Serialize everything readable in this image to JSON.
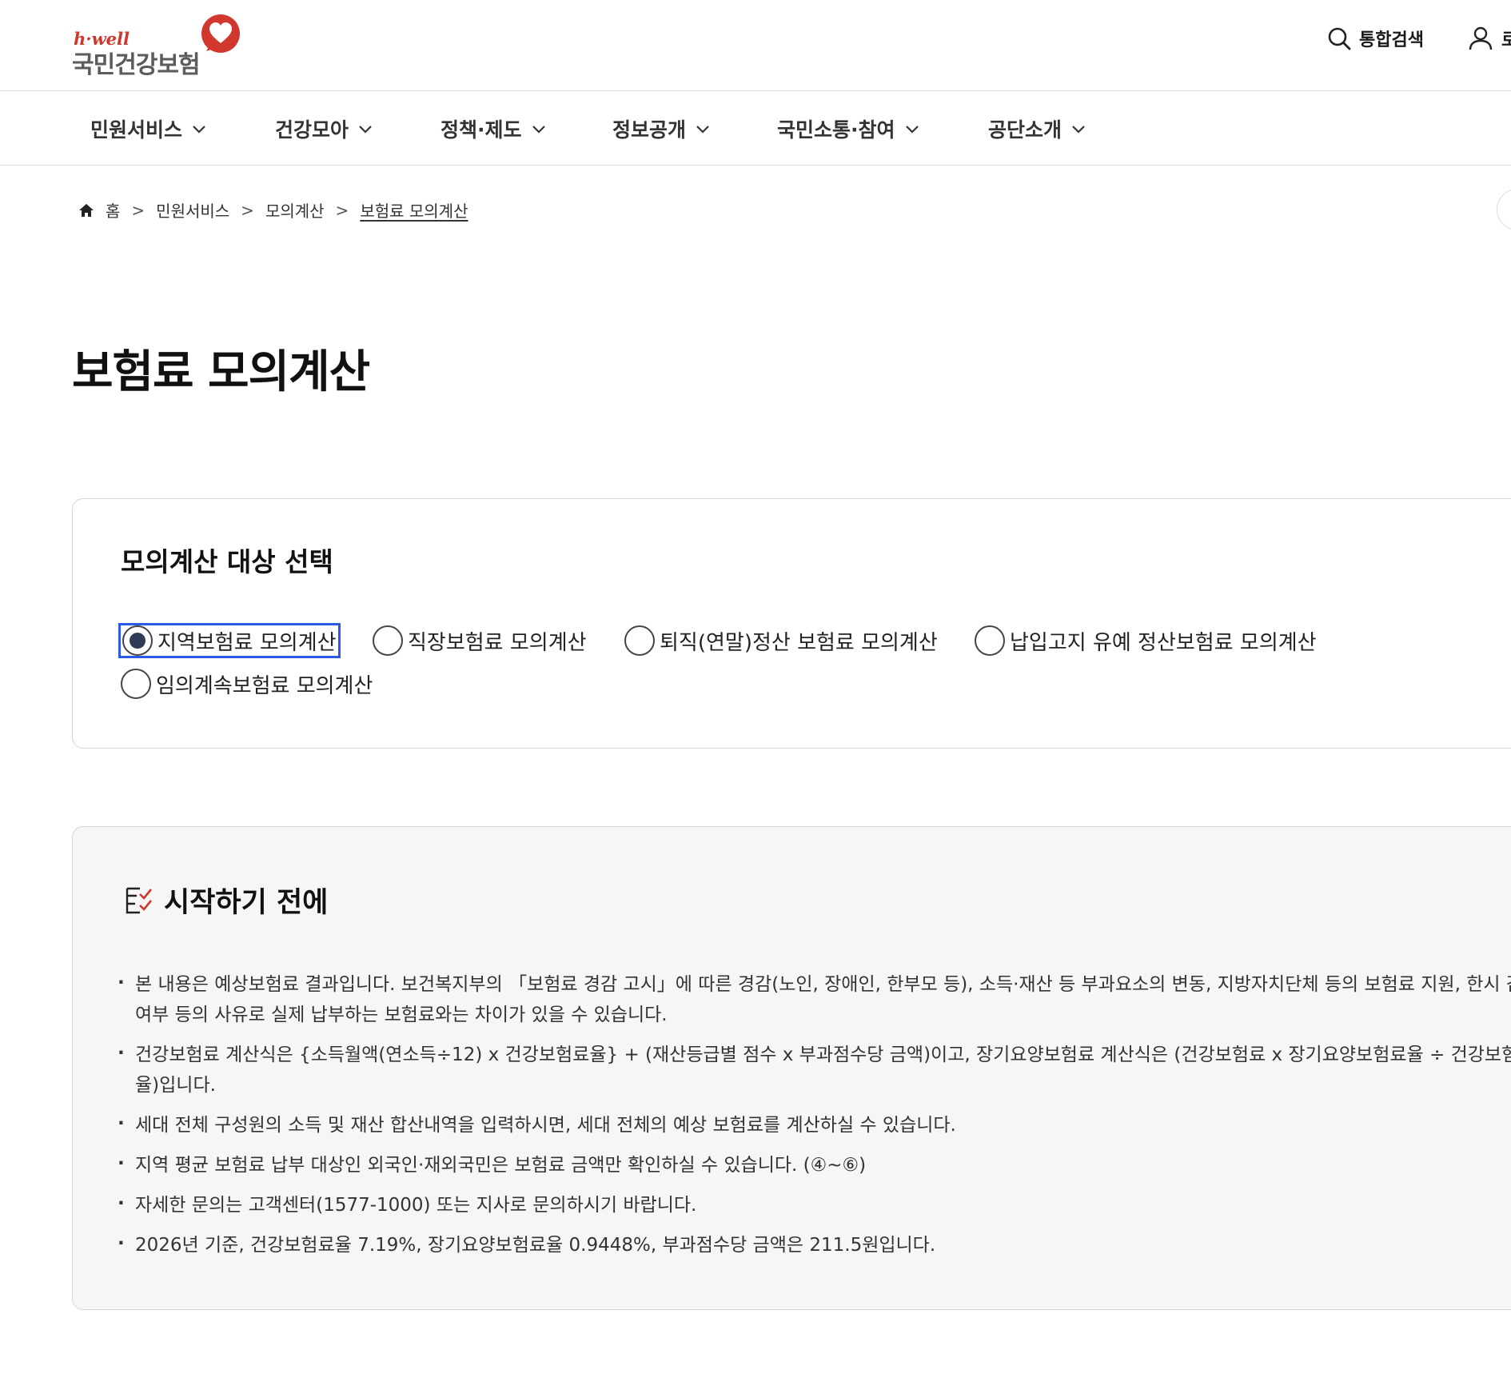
{
  "header": {
    "logo_tag": "h·well",
    "logo_name": "국민건강보험",
    "search_label": "통합검색",
    "user_label": "로"
  },
  "gnb": {
    "items": [
      {
        "label": "민원서비스"
      },
      {
        "label": "건강모아"
      },
      {
        "label": "정책·제도"
      },
      {
        "label": "정보공개"
      },
      {
        "label": "국민소통·참여"
      },
      {
        "label": "공단소개"
      }
    ]
  },
  "breadcrumb": {
    "home": "홈",
    "level1": "민원서비스",
    "level2": "모의계산",
    "current": "보험료 모의계산"
  },
  "page": {
    "title": "보험료 모의계산"
  },
  "selector": {
    "title": "모의계산 대상 선택",
    "options": [
      {
        "label": "지역보험료 모의계산",
        "selected": true
      },
      {
        "label": "직장보험료 모의계산",
        "selected": false
      },
      {
        "label": "퇴직(연말)정산 보험료 모의계산",
        "selected": false
      },
      {
        "label": "납입고지 유예 정산보험료 모의계산",
        "selected": false
      },
      {
        "label": "임의계속보험료 모의계산",
        "selected": false
      }
    ]
  },
  "notice": {
    "title": "시작하기 전에",
    "items": [
      "본 내용은 예상보험료 결과입니다. 보건복지부의 「보험료 경감 고시」에 따른 경감(노인, 장애인, 한부모 등), 소득·재산 등 부과요소의 변동, 지방자치단체 등의 보험료 지원, 한시 감액 여부 등의 사유로 실제 납부하는 보험료와는 차이가 있을 수 있습니다.",
      "건강보험료 계산식은 {소득월액(연소득÷12) x 건강보험료율} + (재산등급별 점수 x 부과점수당 금액)이고, 장기요양보험료 계산식은 (건강보험료 x 장기요양보험료율 ÷ 건강보험료율)입니다.",
      "세대 전체 구성원의 소득 및 재산 합산내역을 입력하시면, 세대 전체의 예상 보험료를 계산하실 수 있습니다.",
      "지역 평균 보험료 납부 대상인 외국인·재외국민은 보험료 금액만 확인하실 수 있습니다. (④~⑥)",
      "자세한 문의는 고객센터(1577-1000) 또는 지사로 문의하시기 바랍니다.",
      "2026년 기준, 건강보험료율 7.19%, 장기요양보험료율 0.9448%, 부과점수당 금액은 211.5원입니다."
    ]
  }
}
